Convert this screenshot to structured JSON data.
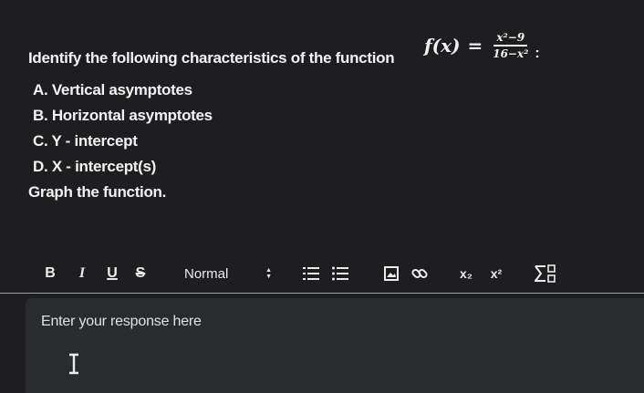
{
  "question": {
    "prompt": "Identify the following characteristics of the function",
    "function": {
      "lhs": "f(x)",
      "equals": "=",
      "numerator": "x²−9",
      "denominator": "16−x²",
      "trailing": ":"
    },
    "items": [
      "A. Vertical asymptotes",
      "B. Horizontal asymptotes",
      "C. Y - intercept",
      "D. X - intercept(s)"
    ],
    "instruction": "Graph the function."
  },
  "toolbar": {
    "bold": "B",
    "italic": "I",
    "underline": "U",
    "strikethrough": "S",
    "format_value": "Normal",
    "subscript": "x₂",
    "superscript": "x²"
  },
  "editor": {
    "placeholder": "Enter your response here"
  },
  "colors": {
    "background": "#1e1e20",
    "editor_background": "#2a2b2d",
    "text": "#f2f2f2",
    "divider": "#9c9c9c"
  }
}
